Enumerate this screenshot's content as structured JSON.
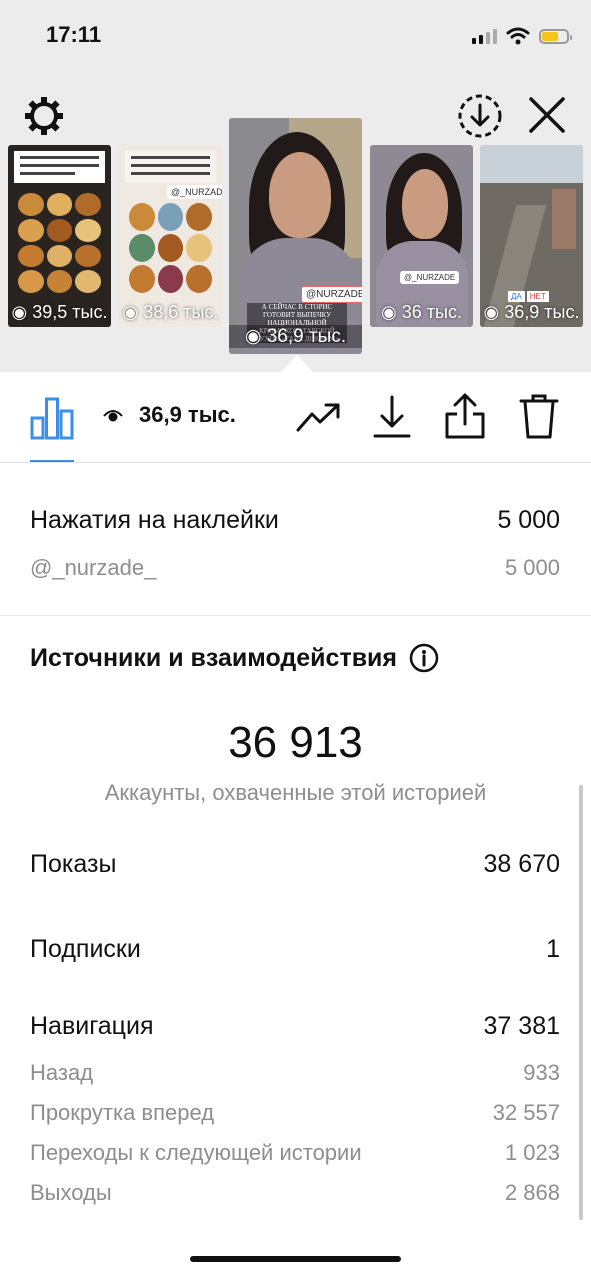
{
  "status_bar": {
    "time": "17:11",
    "battery_level": 0.6
  },
  "top_bar": {
    "settings_icon": "gear-icon",
    "download_icon": "download-circle-icon",
    "close_icon": "close-icon"
  },
  "stories": [
    {
      "views": "39,5 тыс."
    },
    {
      "views": "38,6 тыс."
    },
    {
      "views": "36,9 тыс.",
      "selected": true
    },
    {
      "views": "36 тыс."
    },
    {
      "views": "36,9 тыс."
    }
  ],
  "thumb_text": {
    "story3_sticker": "@NURZADE",
    "story3_caption": "А СЕЙЧАС В СТОРИС ГОТОВИТ ВЫПЕЧКУ НАЦИОНАЛЬНОЙ КРЫМСКОТАТАРСКОЙ КУХНИ «ТАВА ДОКЪУМ»",
    "story2_sticker": "@_NURZADE_",
    "story4_sticker": "@_NURZADE",
    "story5_poll_yes": "ДА",
    "story5_poll_no": "НЕТ"
  },
  "toolbar": {
    "insights_icon": "bar-chart-icon",
    "eye_icon": "eye-icon",
    "views": "36,9 тыс.",
    "promote_icon": "trending-up-icon",
    "save_icon": "download-icon",
    "share_icon": "share-icon",
    "delete_icon": "trash-icon",
    "accent_color": "#3a8ee8"
  },
  "sticker_taps": {
    "label": "Нажатия на наклейки",
    "value": "5 000",
    "sub_label": "@_nurzade_",
    "sub_value": "5 000"
  },
  "sources": {
    "title": "Источники и взаимодействия",
    "info_icon": "info-icon",
    "reach_value": "36 913",
    "reach_caption": "Аккаунты, охваченные этой историей",
    "impressions_label": "Показы",
    "impressions_value": "38 670",
    "follows_label": "Подписки",
    "follows_value": "1",
    "navigation_label": "Навигация",
    "navigation_value": "37 381",
    "back_label": "Назад",
    "back_value": "933",
    "forward_label": "Прокрутка вперед",
    "forward_value": "32 557",
    "next_story_label": "Переходы к следующей истории",
    "next_story_value": "1 023",
    "exits_label": "Выходы",
    "exits_value": "2 868"
  }
}
